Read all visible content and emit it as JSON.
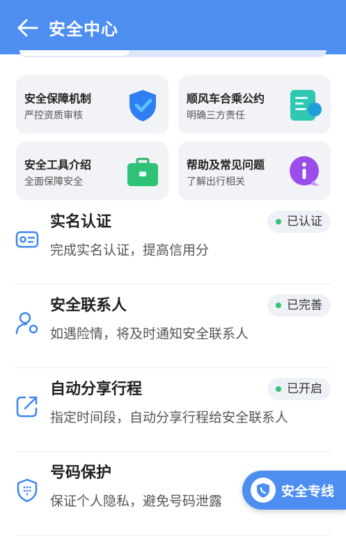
{
  "header": {
    "title": "安全中心"
  },
  "cards": [
    {
      "title": "安全保障机制",
      "sub": "严控资质审核",
      "icon": "shield-check-icon"
    },
    {
      "title": "顺风车合乘公约",
      "sub": "明确三方责任",
      "icon": "document-icon"
    },
    {
      "title": "安全工具介绍",
      "sub": "全面保障安全",
      "icon": "toolbox-icon"
    },
    {
      "title": "帮助及常见问题",
      "sub": "了解出行相关",
      "icon": "info-bubble-icon"
    }
  ],
  "rows": [
    {
      "title": "实名认证",
      "desc": "完成实名认证，提高信用分",
      "status": "已认证",
      "icon": "id-card-icon"
    },
    {
      "title": "安全联系人",
      "desc": "如遇险情，将及时通知安全联系人",
      "status": "已完善",
      "icon": "contact-person-icon"
    },
    {
      "title": "自动分享行程",
      "desc": "指定时间段，自动分享行程给安全联系人",
      "status": "已开启",
      "icon": "share-icon"
    },
    {
      "title": "号码保护",
      "desc": "保证个人隐私，避免号码泄露",
      "status": "",
      "icon": "phone-shield-icon"
    }
  ],
  "float_button": {
    "label": "安全专线"
  },
  "colors": {
    "primary": "#4d8ef0",
    "status_dot": "#37c27a"
  }
}
